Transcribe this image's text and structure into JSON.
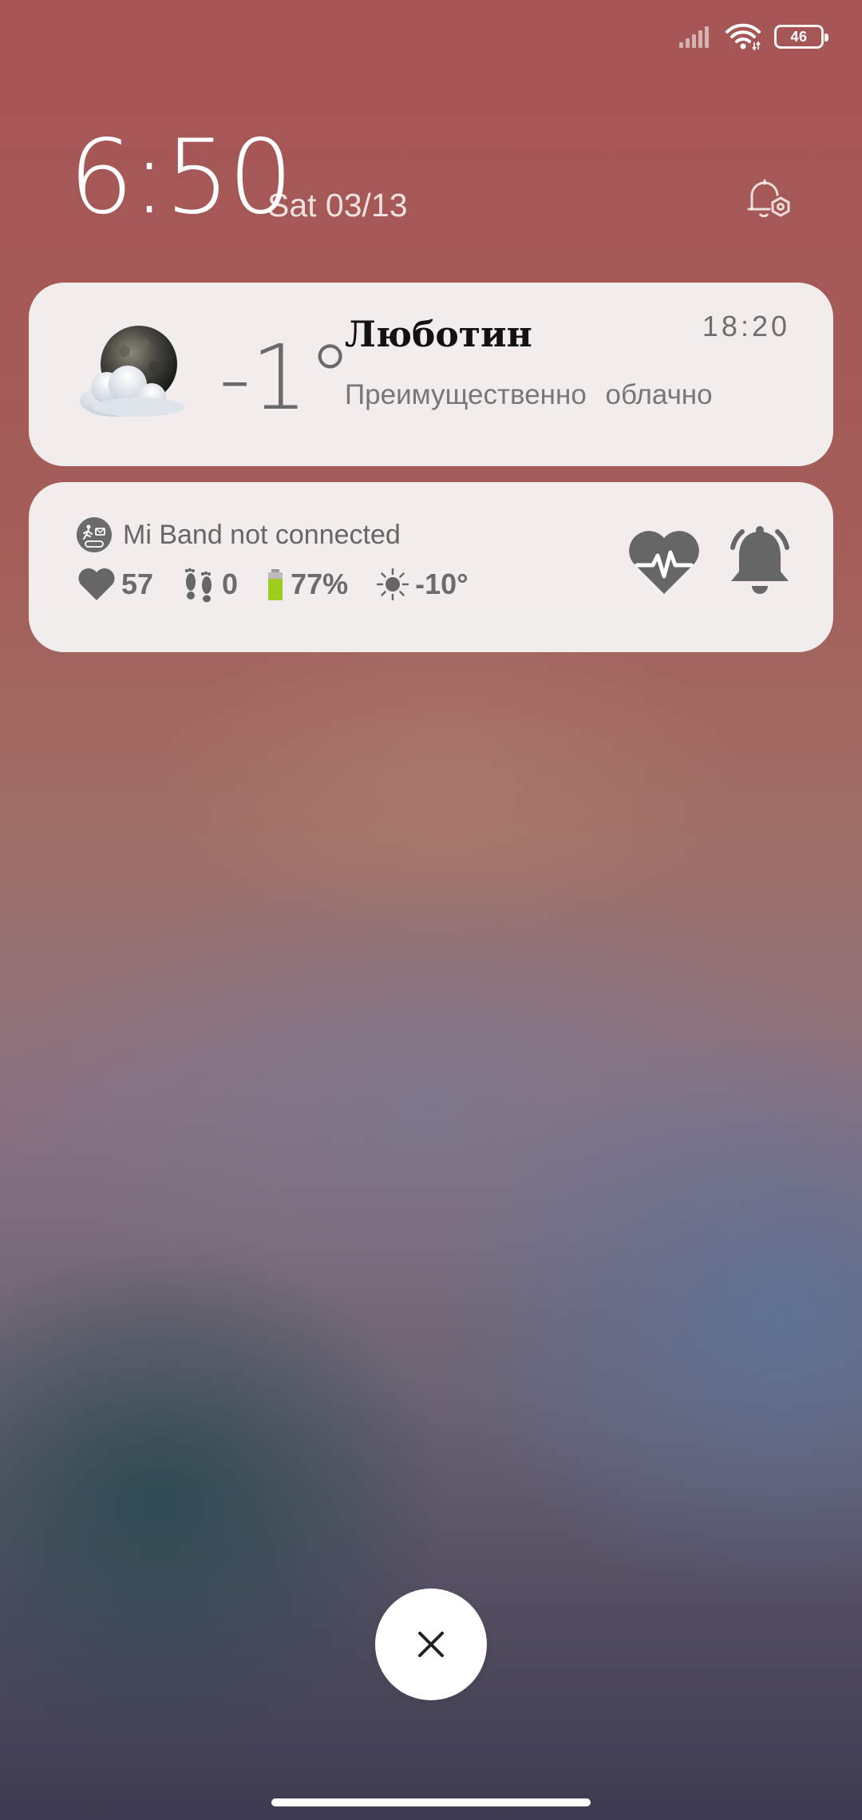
{
  "status_bar": {
    "battery_level": "46",
    "signal_icon": "cellular-signal-icon",
    "wifi_icon": "wifi-icon"
  },
  "lockscreen": {
    "time": "6:50",
    "date": "Sat 03/13",
    "alarm_icon": "alarm-settings-icon"
  },
  "weather": {
    "icon": "night-cloudy-icon",
    "temperature": "-1°",
    "city": "Люботин",
    "updated_time": "18:20",
    "condition": "Преимущественно облачно"
  },
  "band": {
    "status": "Mi Band not connected",
    "heart_rate": "57",
    "steps": "0",
    "battery": "77%",
    "weather_temp": "-10°",
    "battery_level_fraction": 0.77,
    "battery_color": "#9ccc1c"
  },
  "controls": {
    "close_icon": "close-icon"
  }
}
